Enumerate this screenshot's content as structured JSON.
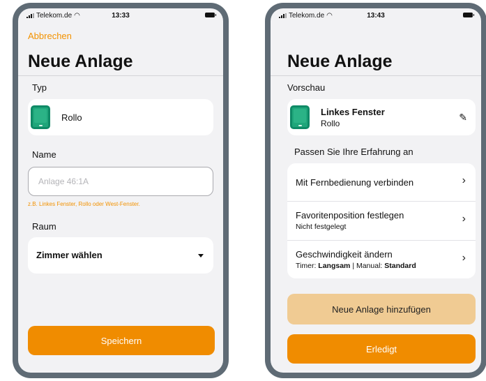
{
  "left_screen": {
    "status": {
      "carrier": "Telekom.de",
      "time": "13:33"
    },
    "cancel_label": "Abbrechen",
    "title": "Neue Anlage",
    "type_section": {
      "label": "Typ",
      "value": "Rollo"
    },
    "name_section": {
      "label": "Name",
      "placeholder": "Anlage 46:1A",
      "hint": "z.B. Linkes Fenster, Rollo oder West-Fenster."
    },
    "room_section": {
      "label": "Raum",
      "value": "Zimmer wählen"
    },
    "save_label": "Speichern"
  },
  "right_screen": {
    "status": {
      "carrier": "Telekom.de",
      "time": "13:43"
    },
    "title": "Neue Anlage",
    "preview_label": "Vorschau",
    "preview_card": {
      "name": "Linkes Fenster",
      "type": "Rollo"
    },
    "customize_label": "Passen Sie Ihre Erfahrung an",
    "options": [
      {
        "title": "Mit Fernbedienung verbinden"
      },
      {
        "title": "Favoritenposition festlegen",
        "subtitle": "Nicht festgelegt"
      },
      {
        "title": "Geschwindigkeit ändern",
        "timer_label": "Timer:",
        "timer_value": "Langsam",
        "separator": "|",
        "manual_label": "Manual:",
        "manual_value": "Standard"
      }
    ],
    "add_label": "Neue Anlage hinzufügen",
    "done_label": "Erledigt"
  },
  "colors": {
    "accent": "#f08c00",
    "accent_light": "#f0cb93",
    "device_green": "#1fa67a",
    "frame": "#5f6b75",
    "screen_bg": "#f2f2f4"
  },
  "icons": [
    "signal-icon",
    "wifi-icon",
    "battery-icon",
    "device-icon",
    "dropdown-caret-icon",
    "pencil-icon",
    "chevron-right-icon"
  ]
}
